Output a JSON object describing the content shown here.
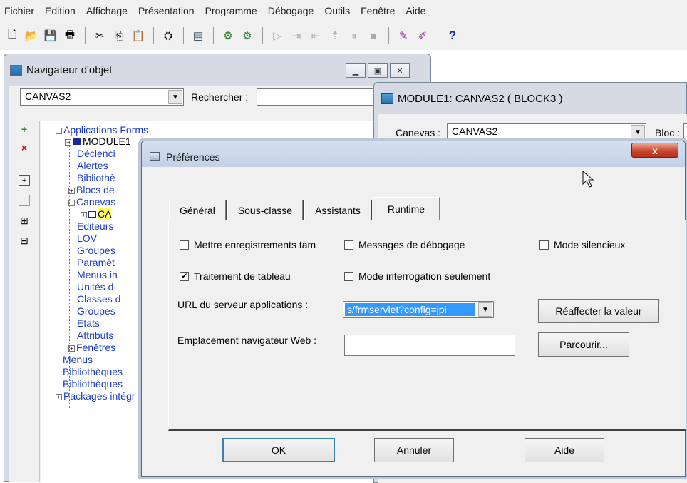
{
  "menubar": {
    "items": [
      "Fichier",
      "Edition",
      "Affichage",
      "Présentation",
      "Programme",
      "Débogage",
      "Outils",
      "Fenêtre",
      "Aide"
    ]
  },
  "toolbar": {
    "icons": [
      "new-icon",
      "open-icon",
      "save-icon",
      "print-icon",
      "cut-icon",
      "copy-icon",
      "paste-icon",
      "compile-icon",
      "run-icon",
      "run-debug-icon",
      "run-web-icon",
      "step-icon",
      "step-over-icon",
      "step-out-icon",
      "pause-icon",
      "stop-icon",
      "wizard-icon",
      "wizard2-icon",
      "help-icon"
    ],
    "help_glyph": "?"
  },
  "navigator": {
    "title": "Navigateur d'objet",
    "combo_value": "CANVAS2",
    "search_label": "Rechercher :",
    "side_icons": [
      "add-icon",
      "delete-icon",
      "expand-icon",
      "collapse-icon",
      "expand-all-icon",
      "collapse-all-icon"
    ],
    "tree": [
      {
        "label": "Applications Forms"
      },
      {
        "label": "MODULE1"
      },
      {
        "label": "Déclenci"
      },
      {
        "label": "Alertes"
      },
      {
        "label": "Bibliothè"
      },
      {
        "label": "Blocs de"
      },
      {
        "label": "Canevas"
      },
      {
        "label": "CA"
      },
      {
        "label": "Editeurs"
      },
      {
        "label": "LOV"
      },
      {
        "label": "Groupes"
      },
      {
        "label": "Paramèt"
      },
      {
        "label": "Menus in"
      },
      {
        "label": "Unités d"
      },
      {
        "label": "Classes d"
      },
      {
        "label": "Groupes"
      },
      {
        "label": "Etats"
      },
      {
        "label": "Attributs"
      },
      {
        "label": "Fenêtres"
      },
      {
        "label": "Menus"
      },
      {
        "label": "Bibliothèques"
      },
      {
        "label": "Bibliothèques"
      },
      {
        "label": "Packages intégr"
      }
    ]
  },
  "module_window": {
    "title": "MODULE1: CANVAS2 ( BLOCK3 )",
    "canvas_label": "Canevas :",
    "canvas_value": "CANVAS2",
    "bloc_label": "Bloc :"
  },
  "dialog": {
    "title": "Préférences",
    "close_glyph": "x",
    "tabs": [
      "Général",
      "Sous-classe",
      "Assistants",
      "Runtime"
    ],
    "active_tab": "Runtime",
    "checkboxes": [
      {
        "label": "Mettre enregistrements tam",
        "checked": false
      },
      {
        "label": "Messages de débogage",
        "checked": false
      },
      {
        "label": "Mode silencieux",
        "checked": false
      },
      {
        "label": "Traitement de tableau",
        "checked": true
      },
      {
        "label": "Mode interrogation seulement",
        "checked": false
      }
    ],
    "url_label": "URL du serveur applications :",
    "url_value": "s/frmservlet?config=jpi",
    "reset_button": "Réaffecter la valeur",
    "web_label": "Emplacement navigateur Web :",
    "web_value": "",
    "browse_button": "Parcourir...",
    "ok_button": "OK",
    "cancel_button": "Annuler",
    "help_button": "Aide"
  }
}
